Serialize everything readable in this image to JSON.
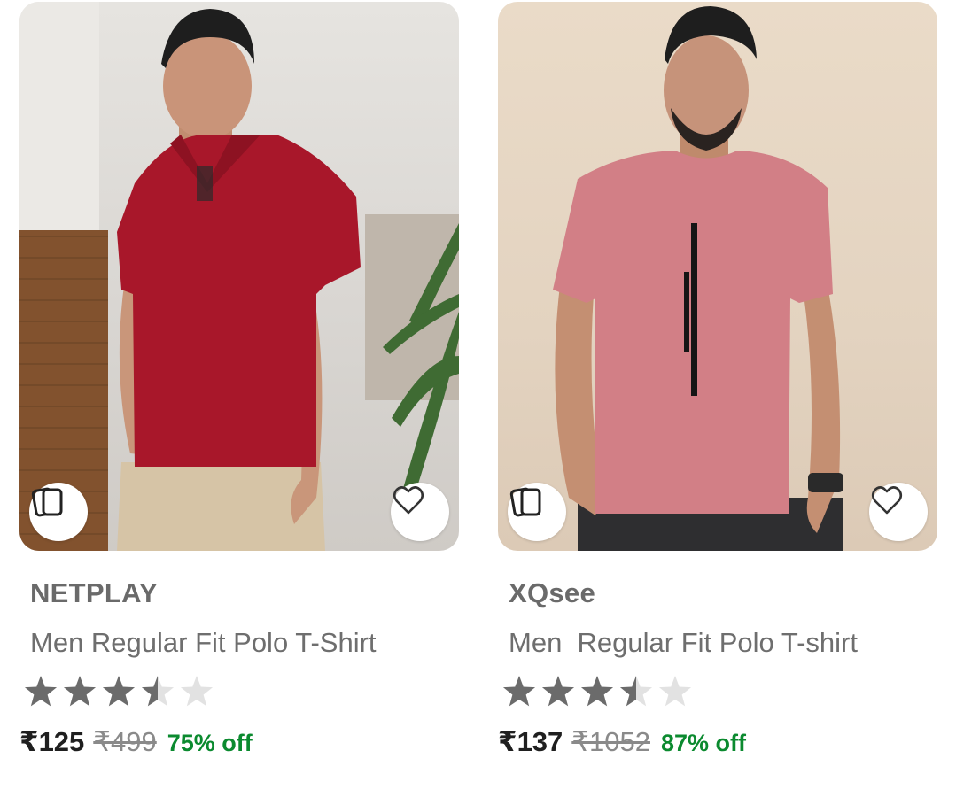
{
  "products": [
    {
      "brand": "NETPLAY",
      "title": "Men Regular Fit Polo T-Shirt",
      "rating": 3.5,
      "rating_max": 5,
      "price": "₹125",
      "mrp": "₹499",
      "discount": "75% off",
      "compare_icon": "compare-cards-icon",
      "wishlist_icon": "heart-outline-icon",
      "image": {
        "shirt_color": "#a8172a",
        "bg_color": "#dedbd7",
        "pants_color": "#d6c4a6"
      }
    },
    {
      "brand": "XQsee",
      "title": "Men  Regular Fit Polo T-shirt",
      "rating": 3.5,
      "rating_max": 5,
      "price": "₹137",
      "mrp": "₹1052",
      "discount": "87% off",
      "compare_icon": "compare-cards-icon",
      "wishlist_icon": "heart-outline-icon",
      "image": {
        "shirt_color": "#d27f86",
        "bg_color": "#e5d6c3",
        "pants_color": "#2e2e30"
      }
    }
  ],
  "colors": {
    "star_filled": "#6b6b6b",
    "star_empty": "#e2e2e2",
    "discount": "#0b8a2f",
    "brand_text": "#6a6a6a"
  }
}
